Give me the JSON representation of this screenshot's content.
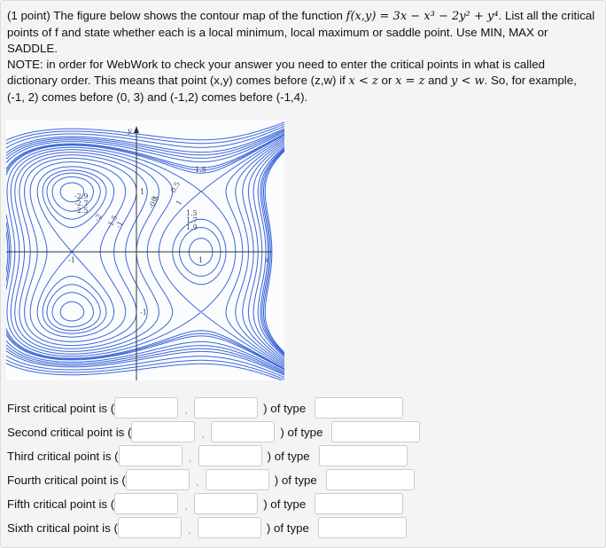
{
  "problem": {
    "intro": "(1 point) The figure below shows the contour map of the function ",
    "function": "f(x,y) = 3x − x³ − 2y² + y⁴",
    "after": ". List all the critical points of f and state whether each is a local minimum, local maximum or saddle point. Use MIN, MAX or SADDLE.",
    "note_a": "NOTE: in order for WebWork to check your answer you need to enter the critical points in what is called dictionary order. This means that point (x,y) comes before (z,w) if ",
    "cond1": "x < z",
    "or": " or ",
    "cond2": "x = z",
    "and": " and ",
    "cond3": "y < w",
    "note_b": ". So, for example, (-1, 2) comes before (0, 3) and (-1,2) comes before (-1,4)."
  },
  "plot": {
    "axis_x_label": "x",
    "axis_y_label": "y",
    "ticks": {
      "x_pos": "1",
      "x_neg": "-1",
      "y_pos": "1",
      "y_neg": "-1"
    },
    "contour_labels": [
      "-2.9",
      "-2.7",
      "-2.5",
      "-2",
      "-1.5",
      "-1",
      "-0.5",
      "0",
      "0.5",
      "1",
      "1.5",
      "1.5",
      "1.7",
      "1.9"
    ],
    "levels": [
      -2.9,
      -2.7,
      -2.5,
      -2.3,
      -2,
      -1.5,
      -1,
      -0.5,
      0,
      0.5,
      1,
      1.5,
      1.7,
      1.9,
      2.5,
      3,
      3.5,
      4,
      5,
      6,
      7
    ],
    "line_color": "#3a66d8"
  },
  "answers": [
    {
      "label": "First critical point is (",
      "x": "",
      "y": "",
      "of_type": ") of type",
      "type": ""
    },
    {
      "label": "Second critical point is (",
      "x": "",
      "y": "",
      "of_type": ") of type",
      "type": ""
    },
    {
      "label": "Third critical point is (",
      "x": "",
      "y": "",
      "of_type": ") of type",
      "type": ""
    },
    {
      "label": "Fourth critical point is (",
      "x": "",
      "y": "",
      "of_type": ") of type",
      "type": ""
    },
    {
      "label": "Fifth critical point is (",
      "x": "",
      "y": "",
      "of_type": ") of type",
      "type": ""
    },
    {
      "label": "Sixth critical point is (",
      "x": "",
      "y": "",
      "of_type": ") of type",
      "type": ""
    }
  ],
  "comma": ","
}
